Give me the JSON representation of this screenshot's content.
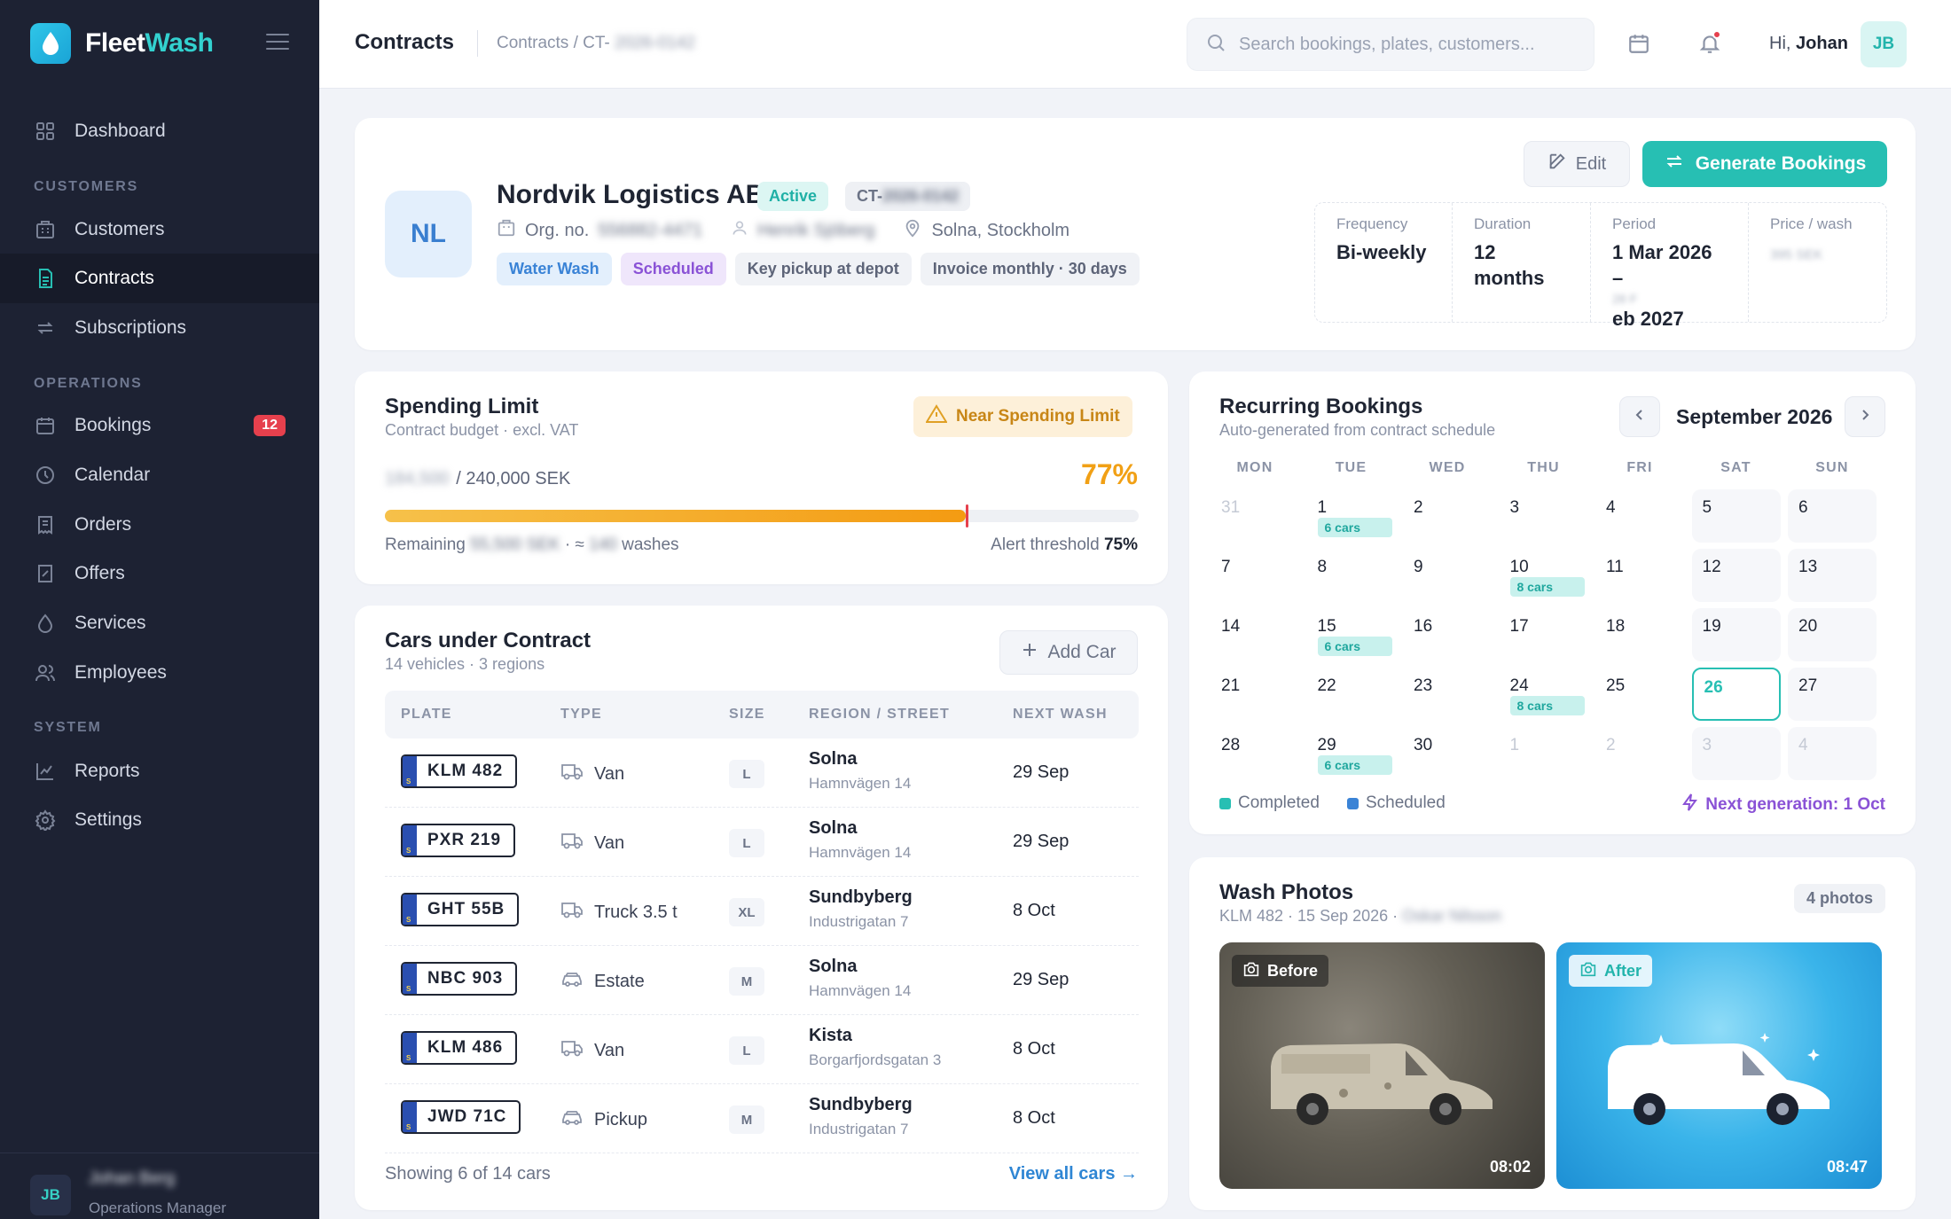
{
  "brand": {
    "name_a": "Fleet",
    "name_b": "Wash"
  },
  "sidebar": {
    "sections": {
      "customers": "CUSTOMERS",
      "operations": "OPERATIONS",
      "system": "SYSTEM"
    },
    "items": [
      {
        "label": "Dashboard",
        "icon": "grid-icon"
      },
      {
        "label": "Customers",
        "icon": "building-icon"
      },
      {
        "label": "Contracts",
        "icon": "document-icon",
        "active": true
      },
      {
        "label": "Subscriptions",
        "icon": "repeat-icon"
      },
      {
        "label": "Bookings",
        "icon": "calendar-icon",
        "badge": "12"
      },
      {
        "label": "Calendar",
        "icon": "clock-icon"
      },
      {
        "label": "Orders",
        "icon": "receipt-icon"
      },
      {
        "label": "Offers",
        "icon": "tag-icon"
      },
      {
        "label": "Services",
        "icon": "droplet-icon"
      },
      {
        "label": "Employees",
        "icon": "users-icon"
      },
      {
        "label": "Reports",
        "icon": "chart-icon"
      },
      {
        "label": "Settings",
        "icon": "gear-icon"
      }
    ],
    "user": {
      "initials": "JB",
      "name": "Johan Berg",
      "role": "Operations Manager"
    }
  },
  "topbar": {
    "title": "Contracts",
    "breadcrumb_prefix": "Contracts / CT-",
    "breadcrumb_id": "2026-0142",
    "search_placeholder": "Search bookings, plates, customers...",
    "greeting": "Hi,",
    "user_first": "Johan",
    "user_initials": "JB"
  },
  "contract": {
    "initials": "NL",
    "name": "Nordvik Logistics AB",
    "status": "Active",
    "ct_prefix": "CT-",
    "ct_id": "2026-0142",
    "org_label": "Org. no.",
    "org_no": "556882-4471",
    "contact": "Henrik Sjöberg",
    "location": "Solna, Stockholm",
    "tags": [
      "Water Wash",
      "Scheduled",
      "Key pickup at depot",
      "Invoice monthly · 30 days"
    ],
    "edit_label": "Edit",
    "generate_label": "Generate Bookings",
    "stats": [
      {
        "k": "Frequency",
        "v": "Bi-weekly"
      },
      {
        "k": "Duration",
        "v": "12 months"
      },
      {
        "k": "Period",
        "v1": "1 Mar 2026 –",
        "v2": "28 F",
        "v3": "eb 2027"
      },
      {
        "k": "Price / wash",
        "v": "395 SEK"
      }
    ]
  },
  "spending": {
    "title": "Spending Limit",
    "subtitle": "Contract budget · excl. VAT",
    "warning": "Near Spending Limit",
    "used": "184,500",
    "total": "/ 240,000 SEK",
    "percent": "77%",
    "fill_fraction": 0.77,
    "threshold_fraction": 0.75,
    "remaining_label": "Remaining",
    "remaining_value": "55,500 SEK",
    "approx": "· ≈",
    "washes_count": "140",
    "washes_label": "washes",
    "alert_label": "Alert threshold",
    "alert_value": "75%"
  },
  "cars": {
    "title": "Cars under Contract",
    "subtitle": "14 vehicles · 3 regions",
    "add_label": "Add Car",
    "headers": [
      "PLATE",
      "TYPE",
      "SIZE",
      "REGION / STREET",
      "NEXT WASH"
    ],
    "rows": [
      {
        "plate": "KLM 482",
        "type": "Van",
        "type_icon": "truck-icon",
        "size": "L",
        "region": "Solna",
        "street": "Hamnvägen 14",
        "next": "29 Sep"
      },
      {
        "plate": "PXR 219",
        "type": "Van",
        "type_icon": "truck-icon",
        "size": "L",
        "region": "Solna",
        "street": "Hamnvägen 14",
        "next": "29 Sep"
      },
      {
        "plate": "GHT 55B",
        "type": "Truck 3.5 t",
        "type_icon": "truck-icon",
        "size": "XL",
        "region": "Sundbyberg",
        "street": "Industrigatan 7",
        "next": "8 Oct"
      },
      {
        "plate": "NBC 903",
        "type": "Estate",
        "type_icon": "car-icon",
        "size": "M",
        "region": "Solna",
        "street": "Hamnvägen 14",
        "next": "29 Sep"
      },
      {
        "plate": "KLM 486",
        "type": "Van",
        "type_icon": "truck-icon",
        "size": "L",
        "region": "Kista",
        "street": "Borgarfjordsgatan 3",
        "next": "8 Oct"
      },
      {
        "plate": "JWD 71C",
        "type": "Pickup",
        "type_icon": "car-icon",
        "size": "M",
        "region": "Sundbyberg",
        "street": "Industrigatan 7",
        "next": "8 Oct"
      }
    ],
    "footer": "Showing 6 of 14 cars",
    "view_all": "View all cars →"
  },
  "calendar": {
    "title": "Recurring Bookings",
    "subtitle": "Auto-generated from contract schedule",
    "month": "September 2026",
    "dow": [
      "MON",
      "TUE",
      "WED",
      "THU",
      "FRI",
      "SAT",
      "SUN"
    ],
    "weeks": [
      [
        {
          "d": "31",
          "m": true
        },
        {
          "d": "1",
          "c": "6 cars"
        },
        {
          "d": "2"
        },
        {
          "d": "3"
        },
        {
          "d": "4"
        },
        {
          "d": "5"
        },
        {
          "d": "6"
        }
      ],
      [
        {
          "d": "7"
        },
        {
          "d": "8"
        },
        {
          "d": "9"
        },
        {
          "d": "10",
          "c": "8 cars"
        },
        {
          "d": "11"
        },
        {
          "d": "12"
        },
        {
          "d": "13"
        }
      ],
      [
        {
          "d": "14"
        },
        {
          "d": "15",
          "c": "6 cars"
        },
        {
          "d": "16"
        },
        {
          "d": "17"
        },
        {
          "d": "18"
        },
        {
          "d": "19"
        },
        {
          "d": "20"
        }
      ],
      [
        {
          "d": "21"
        },
        {
          "d": "22"
        },
        {
          "d": "23"
        },
        {
          "d": "24",
          "c": "8 cars"
        },
        {
          "d": "25"
        },
        {
          "d": "26",
          "today": true
        },
        {
          "d": "27"
        }
      ],
      [
        {
          "d": "28"
        },
        {
          "d": "29",
          "c": "6 cars"
        },
        {
          "d": "30"
        },
        {
          "d": "1",
          "m": true
        },
        {
          "d": "2",
          "m": true
        },
        {
          "d": "3",
          "m": true
        },
        {
          "d": "4",
          "m": true
        }
      ]
    ],
    "legend_completed": "Completed",
    "legend_scheduled": "Scheduled",
    "completed_color": "#27bfb3",
    "scheduled_color": "#3a83d6",
    "next_gen": "Next generation: 1 Oct"
  },
  "photos": {
    "title": "Wash Photos",
    "subtitle": "KLM 482 · 15 Sep 2026 ·",
    "photographer": "Oskar Nilsson",
    "count": "4 photos",
    "before_label": "Before",
    "before_time": "08:02",
    "after_label": "After",
    "after_time": "08:47"
  }
}
